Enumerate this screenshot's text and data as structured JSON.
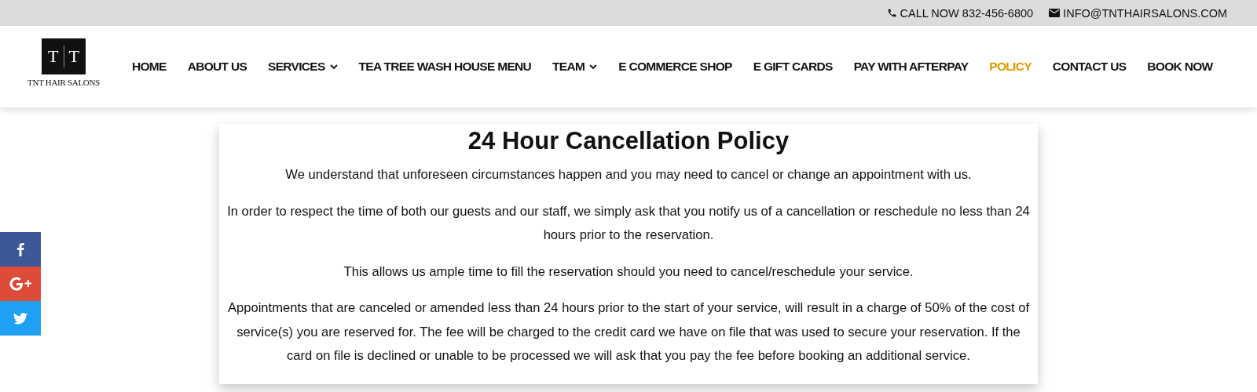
{
  "top_bar": [
    {
      "kind": "phone",
      "text": "CALL NOW 832-456-6800"
    },
    {
      "kind": "email",
      "text": "INFO@TNTHAIRSALONS.COM"
    }
  ],
  "logo": {
    "mark_left": "T",
    "mark_right": "T",
    "name": "TNT HAIR SALONS"
  },
  "nav": [
    {
      "label": "HOME",
      "dropdown": false,
      "selected": false
    },
    {
      "label": "ABOUT US",
      "dropdown": false,
      "selected": false
    },
    {
      "label": "SERVICES",
      "dropdown": true,
      "selected": false
    },
    {
      "label": "TEA TREE WASH HOUSE MENU",
      "dropdown": false,
      "selected": false
    },
    {
      "label": "TEAM",
      "dropdown": true,
      "selected": false
    },
    {
      "label": "E COMMERCE SHOP",
      "dropdown": false,
      "selected": false
    },
    {
      "label": "E GIFT CARDS",
      "dropdown": false,
      "selected": false
    },
    {
      "label": "PAY WITH AFTERPAY",
      "dropdown": false,
      "selected": false
    },
    {
      "label": "POLICY",
      "dropdown": false,
      "selected": true
    },
    {
      "label": "CONTACT US",
      "dropdown": false,
      "selected": false
    },
    {
      "label": "BOOK NOW",
      "dropdown": false,
      "selected": false
    }
  ],
  "sections": [
    {
      "title": "24 Hour Cancellation Policy",
      "paragraphs": [
        "We understand that unforeseen circumstances happen and you may need to cancel or change an appointment with us.",
        "In order to respect the time of both our guests and our staff, we simply ask that you notify us of a cancellation or reschedule no less than 24 hours prior to the reservation.",
        "This allows us ample time to fill the reservation should you need to cancel/reschedule your service.",
        "Appointments that are canceled or amended less than 24 hours prior to the start of your service, will result in a charge of 50% of the cost of service(s) you are reserved for. The fee will be charged to the credit card we have on file that was used to secure your reservation. If the card on file is declined or unable to be processed we will ask that you pay the fee before booking an additional service."
      ]
    }
  ],
  "share": [
    {
      "kind": "facebook"
    },
    {
      "kind": "googleplus"
    },
    {
      "kind": "twitter"
    }
  ]
}
